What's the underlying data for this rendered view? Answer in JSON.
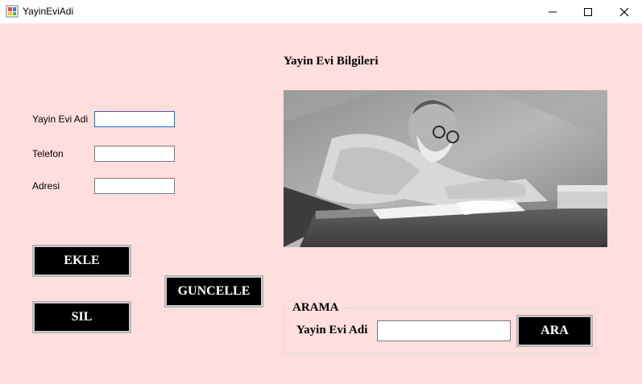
{
  "window": {
    "title": "YayinEviAdi",
    "controls": {
      "minimize_icon": "minimize-icon",
      "maximize_icon": "maximize-icon",
      "close_icon": "close-icon"
    }
  },
  "form": {
    "heading": "Yayin Evi Bilgileri",
    "fields": {
      "name_label": "Yayin Evi Adi",
      "name_value": "",
      "phone_label": "Telefon",
      "phone_value": "",
      "address_label": "Adresi",
      "address_value": ""
    },
    "buttons": {
      "add": "EKLE",
      "update": "GUNCELLE",
      "delete": "SIL"
    }
  },
  "photo": {
    "icon": "author-photo"
  },
  "search": {
    "group_title": "ARAMA",
    "label": "Yayin Evi Adi",
    "value": "",
    "button": "ARA"
  },
  "colors": {
    "background": "#ffdfdd",
    "button": "#000000",
    "button_text": "#ffffff",
    "focus_border": "#0078d7"
  }
}
